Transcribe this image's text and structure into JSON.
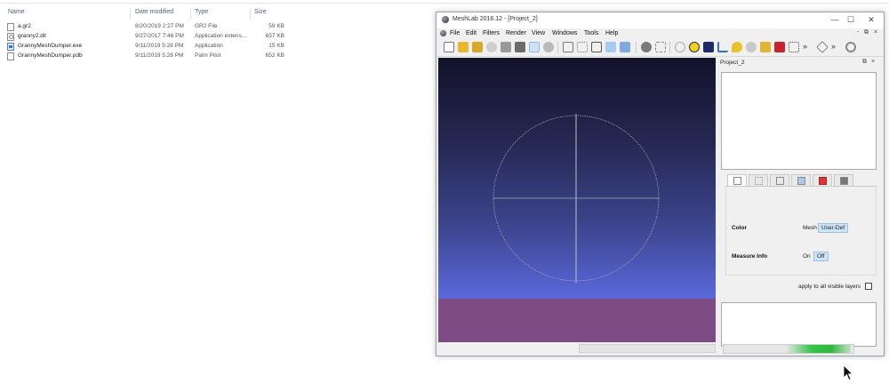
{
  "explorer": {
    "columns": {
      "name": "Name",
      "date": "Date modified",
      "type": "Type",
      "size": "Size"
    },
    "files": [
      {
        "name": "a.gr2",
        "date": "8/20/2019 2:27 PM",
        "type": "GR2 File",
        "size": "59 KB",
        "icon": "file-icon"
      },
      {
        "name": "granny2.dll",
        "date": "9/27/2017 7:46 PM",
        "type": "Application extens...",
        "size": "657 KB",
        "icon": "dll-icon"
      },
      {
        "name": "GrannyMeshDumper.exe",
        "date": "9/11/2019 5:28 PM",
        "type": "Application",
        "size": "15 KB",
        "icon": "exe-icon"
      },
      {
        "name": "GrannyMeshDumper.pdb",
        "date": "9/11/2019 5:28 PM",
        "type": "Palm Pilot",
        "size": "652 KB",
        "icon": "file-icon"
      }
    ]
  },
  "meshlab": {
    "title": "MeshLab 2016.12 - [Project_2]",
    "window_controls": {
      "minimize": "—",
      "maximize": "☐",
      "close": "✕"
    },
    "menu": [
      "File",
      "Edit",
      "Filters",
      "Render",
      "View",
      "Windows",
      "Tools",
      "Help"
    ],
    "menu_controls": {
      "minimize": "-",
      "restore": "⧉",
      "close": "×"
    },
    "toolbar_overflow": "»",
    "panel": {
      "title": "Project_2",
      "controls": {
        "float": "⧉",
        "close": "×"
      },
      "properties": [
        {
          "label": "Color",
          "options": [
            {
              "text": "Mesh",
              "selected": false
            },
            {
              "text": "User-Def",
              "selected": true
            }
          ]
        },
        {
          "label": "Measure Info",
          "options": [
            {
              "text": "On",
              "selected": false
            },
            {
              "text": "Off",
              "selected": true
            }
          ]
        }
      ],
      "apply_label": "apply to all visible layers"
    },
    "progress_fraction": 0.5,
    "colors": {
      "viewport_top": "#13122a",
      "viewport_bottom": "#6974ea",
      "ground": "#7f4b85",
      "selected": "#cfe3f7"
    }
  }
}
